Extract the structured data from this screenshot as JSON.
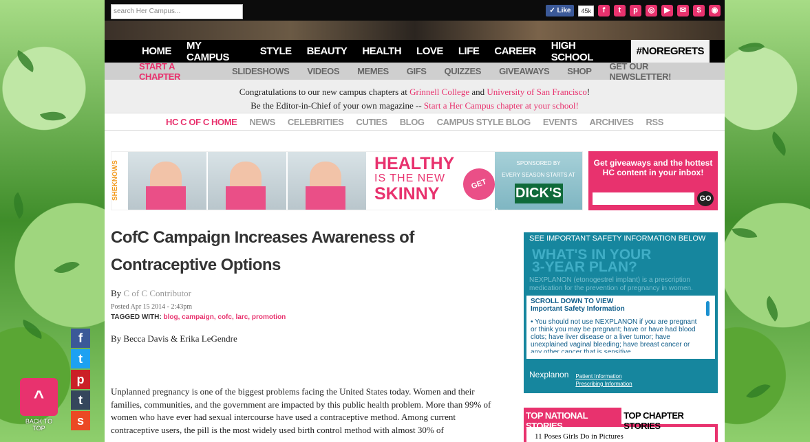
{
  "topbar": {
    "search_placeholder": "search Her Campus...",
    "like_label": "✓ Like",
    "like_count": "45k",
    "social_icons": [
      "facebook-icon",
      "twitter-icon",
      "pinterest-icon",
      "instagram-icon",
      "youtube-icon",
      "email-icon",
      "shop-icon",
      "rss-icon"
    ]
  },
  "mainnav": [
    "HOME",
    "MY CAMPUS",
    "STYLE",
    "BEAUTY",
    "HEALTH",
    "LOVE",
    "LIFE",
    "CAREER",
    "HIGH SCHOOL",
    "#NOREGRETS"
  ],
  "subnav": [
    "START A CHAPTER",
    "SLIDESHOWS",
    "VIDEOS",
    "MEMES",
    "GIFS",
    "QUIZZES",
    "GIVEAWAYS",
    "SHOP",
    "GET OUR NEWSLETTER!"
  ],
  "announce": {
    "line1_pre": "Congratulations to our new campus chapters at ",
    "link1": "Grinnell College",
    "and": " and ",
    "link2": "University of San Francisco",
    "line1_post": "!",
    "line2_pre": "Be the Editor-in-Chief of your own magazine -- ",
    "link3": "Start a Her Campus chapter at your school!"
  },
  "chapnav": [
    "HC C OF C HOME",
    "NEWS",
    "CELEBRITIES",
    "CUTIES",
    "BLOG",
    "CAMPUS STYLE BLOG",
    "EVENTS",
    "ARCHIVES",
    "RSS"
  ],
  "ad": {
    "brand": "SHEKNOWS",
    "line1": "HEALTHY",
    "line2": "IS THE NEW",
    "line3": "SKINNY",
    "tips": "GET TIPS!",
    "sponsored": "SPONSORED BY",
    "tagline": "EVERY SEASON STARTS AT",
    "sponsor": "DICK'S"
  },
  "newsletter": {
    "text": "Get giveaways and the hottest HC content in your inbox!",
    "go": "GO"
  },
  "article": {
    "title": "CofC Campaign Increases Awareness of Contraceptive Options",
    "by": "By ",
    "author": "C of C Contributor",
    "posted": "Posted Apr 15 2014 - 2:43pm",
    "tagged_label": "TAGGED WITH: ",
    "tags": "blog, campaign, cofc, larc, promotion",
    "authors": "By Becca Davis & Erika LeGendre",
    "body": "Unplanned pregnancy is one of the biggest problems facing the United States today. Women and their families, communities, and the government are impacted by this public health problem. More than 99% of women who have ever had sexual intercourse have used a contraceptive method. Among current contraceptive users, the pill is the most widely used birth control method with almost 30% of"
  },
  "sidead": {
    "header": "SEE IMPORTANT SAFETY INFORMATION BELOW",
    "big1": "WHAT'S IN YOUR",
    "big2": "3-YEAR PLAN?",
    "desc": "NEXPLANON (etonogestrel implant) is a prescription medication for the prevention of pregnancy in women.",
    "isi_title1": "SCROLL DOWN TO VIEW",
    "isi_title2": "Important Safety Information",
    "isi_body": "• You should not use NEXPLANON if you are pregnant or think you may be pregnant; have or have had blood clots; have liver disease or a liver tumor; have unexplained vaginal bleeding; have breast cancer or any other cancer that is sensitive",
    "brand": "Nexplanon",
    "link1": "Patient Information",
    "link2": "Prescribing Information"
  },
  "stories": {
    "tab1": "TOP NATIONAL STORIES",
    "tab2": "TOP CHAPTER STORIES",
    "item1": "11 Poses Girls Do in Pictures"
  },
  "share": {
    "icons": [
      "facebook-icon",
      "twitter-icon",
      "pinterest-icon",
      "tumblr-icon",
      "stumbleupon-icon"
    ],
    "back_to_top": "BACK TO TOP"
  },
  "colors": {
    "accent": "#e8326e",
    "nav_bg": "#000000",
    "sidebar_ad": "#16869e"
  }
}
